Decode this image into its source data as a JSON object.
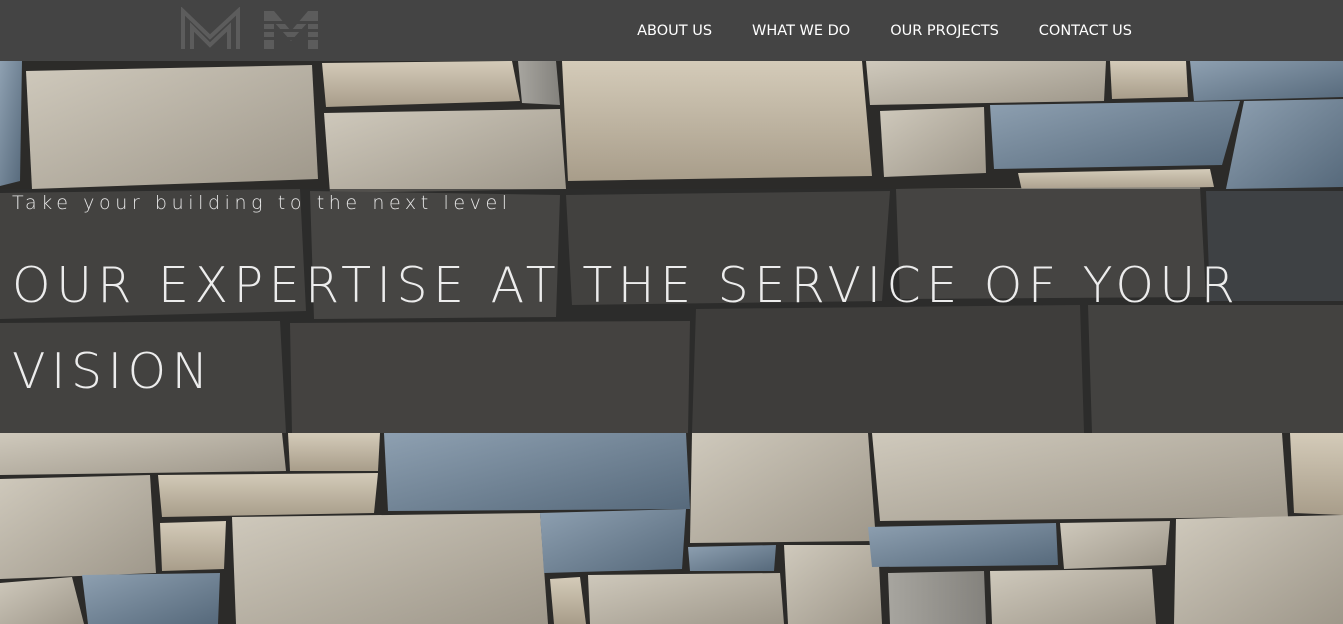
{
  "brand": {
    "logo_icon": "mm-monogram-logo"
  },
  "nav": {
    "items": [
      {
        "label": "ABOUT US"
      },
      {
        "label": "WHAT WE DO"
      },
      {
        "label": "OUR PROJECTS"
      },
      {
        "label": "CONTACT US"
      }
    ]
  },
  "hero": {
    "tagline": "Take your building to the next level",
    "headline": "OUR EXPERTISE AT THE SERVICE OF YOUR VISION",
    "background": "stone-wall-photo"
  },
  "colors": {
    "navbar": "#444444",
    "nav_text": "#ffffff",
    "banner_overlay": "rgba(45,45,45,0.72)",
    "stone_light": "#b9b3a6",
    "stone_blue": "#6f8294",
    "mortar": "#2a2a2a"
  }
}
